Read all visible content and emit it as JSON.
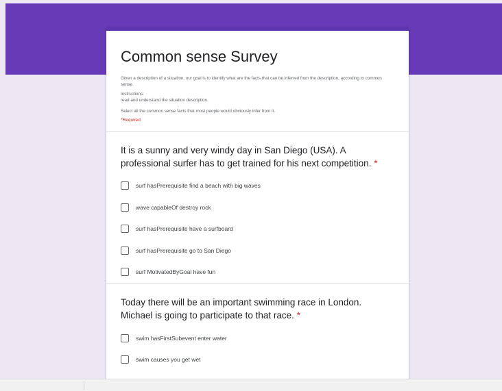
{
  "form": {
    "title": "Common sense Survey",
    "description": "Given a description of a situation, our goal is to identify what are the facts that can be inferred from the description, according to common sense.",
    "instructions_heading": "Instructions:",
    "instructions": [
      "read and understand the situation description.",
      "Select all the common sense facts that most people would obviously infer from it."
    ],
    "required_note": "*Required"
  },
  "questions": [
    {
      "text": "It is a sunny and very windy day in San Diego (USA). A professional surfer has to get trained for his next competition.",
      "required_mark": "*",
      "options": [
        "surf hasPrerequisite find a beach with big waves",
        "wave capableOf destroy rock",
        "surf hasPrerequisite have a surfboard",
        "surf hasPrerequisite go to San Diego",
        "surf MotivatedByGoal have fun"
      ]
    },
    {
      "text": "Today there will be an important swimming race in London. Michael is going to participate to that race.",
      "required_mark": "*",
      "options": [
        "swim hasFirstSubevent enter water",
        "swim causes you get wet"
      ]
    }
  ],
  "colors": {
    "header": "#673ab7",
    "background": "#ede7f4",
    "required": "#d93025"
  }
}
